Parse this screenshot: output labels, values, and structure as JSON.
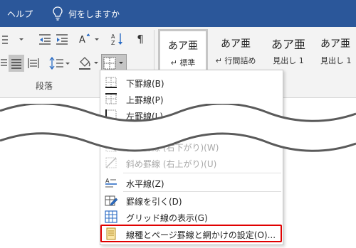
{
  "titlebar": {
    "help": "ヘルプ",
    "tell_me": "何をしますか",
    "bg": "#2b579a"
  },
  "ribbon": {
    "group_label": "段落"
  },
  "styles": [
    {
      "sample": "あア亜",
      "name": "↵ 標準"
    },
    {
      "sample": "あア亜",
      "name": "↵ 行間詰め"
    },
    {
      "sample": "あア亜",
      "name": "見出し 1"
    },
    {
      "sample": "あア亜",
      "name": "見出し 1"
    }
  ],
  "menu": {
    "items": [
      {
        "label": "下罫線(B)",
        "icon": "bottom-border-icon"
      },
      {
        "label": "上罫線(P)",
        "icon": "top-border-icon"
      },
      {
        "label": "左罫線(L)",
        "icon": "left-border-icon"
      },
      {
        "label": "斜め罫線 (右下がり)(W)",
        "icon": "diag-down-border-icon"
      },
      {
        "label": "斜め罫線 (右上がり)(U)",
        "icon": "diag-up-border-icon"
      },
      {
        "label": "水平線(Z)",
        "icon": "horizontal-line-icon"
      },
      {
        "label": "罫線を引く(D)",
        "icon": "draw-table-icon"
      },
      {
        "label": "グリッド線の表示(G)",
        "icon": "view-gridlines-icon"
      },
      {
        "label": "線種とページ罫線と網かけの設定(O)...",
        "icon": "borders-shading-icon"
      }
    ]
  },
  "highlight_color": "#e00000"
}
